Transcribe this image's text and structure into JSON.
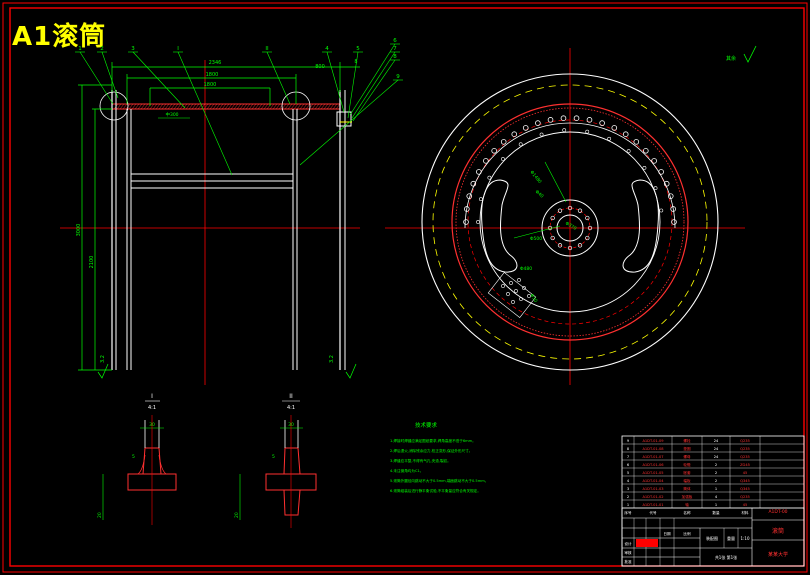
{
  "title": "A1滚筒",
  "colors": {
    "background": "#000000",
    "frame": "#ff0000",
    "outline": "#ffffff",
    "dim": "#00ff00",
    "center": "#ff0000",
    "hidden": "#ffff00",
    "title": "#ffff00",
    "table": "#ff0000"
  },
  "front_view": {
    "callouts": [
      "1",
      "2",
      "3",
      "I",
      "II",
      "4",
      "5",
      "6",
      "7",
      "8",
      "9"
    ],
    "dims": {
      "top1": "2346",
      "top2": "1800",
      "top3": "1800",
      "left_outer": "3000",
      "left_inner": "2100",
      "right_top": "800",
      "right_small": "8",
      "inner_small": "中300",
      "bottom_left": "3.2",
      "bottom_right": "3.2"
    }
  },
  "side_view": {
    "surface_note": "其余",
    "dims": {
      "d_bolt": "Φ1480",
      "d_hub": "Φ370",
      "d_pitch": "Φ1480",
      "d_hole": "Φ40",
      "d_inner": "Φ500",
      "d_small": "Φ30",
      "d_slot": "Φ480"
    }
  },
  "details": [
    {
      "label": "I",
      "scale": "4:1",
      "dim_top": "30",
      "dim_side": "5",
      "dim_height": "20"
    },
    {
      "label": "II",
      "scale": "4:1",
      "dim_top": "30",
      "dim_side": "5",
      "dim_height": "20"
    }
  ],
  "tech_notes": {
    "title": "技术要求",
    "lines": [
      "1.焊接时焊缝应满足图纸要求,焊角高度不低于6mm。",
      "2.焊后退火,消除残余应力,校正变形,保证外形尺寸。",
      "3.焊缝应平整,不得有气孔,夹渣,裂纹。",
      "4.未注倒角均为C1。",
      "5.滚筒外圆径向跳动不大于0.5mm,端面跳动不大于0.5mm。",
      "6.滚筒组装后进行静平衡试验,不平衡量应符合有关规定。"
    ]
  },
  "parts_list": {
    "rows": [
      {
        "no": "9",
        "code": "A1DT-01-09",
        "name": "螺栓",
        "qty": "24",
        "mat": "Q235"
      },
      {
        "no": "8",
        "code": "A1DT-01-08",
        "name": "垫圈",
        "qty": "24",
        "mat": "Q235"
      },
      {
        "no": "7",
        "code": "A1DT-01-07",
        "name": "螺母",
        "qty": "24",
        "mat": "Q235"
      },
      {
        "no": "6",
        "code": "A1DT-01-06",
        "name": "轮毂",
        "qty": "2",
        "mat": "ZG45"
      },
      {
        "no": "5",
        "code": "A1DT-01-05",
        "name": "胀套",
        "qty": "2",
        "mat": "45"
      },
      {
        "no": "4",
        "code": "A1DT-01-04",
        "name": "幅板",
        "qty": "2",
        "mat": "Q345"
      },
      {
        "no": "3",
        "code": "A1DT-01-03",
        "name": "筒体",
        "qty": "1",
        "mat": "Q345"
      },
      {
        "no": "2",
        "code": "A1DT-01-02",
        "name": "加强板",
        "qty": "4",
        "mat": "Q235"
      },
      {
        "no": "1",
        "code": "A1DT-01-01",
        "name": "轴",
        "qty": "1",
        "mat": "45"
      }
    ],
    "header": {
      "no": "序号",
      "code": "代号",
      "name": "名称",
      "qty": "数量",
      "mat": "材料"
    }
  },
  "title_block": {
    "drawing_no": "A1DT-00",
    "name": "滚筒",
    "scale": "1:10",
    "company": "某某大学",
    "material": "装配图",
    "sheet": "共1张 第1张",
    "designer": "设计",
    "checker": "审核",
    "approver": "批准",
    "date": "日期",
    "weight": "重量",
    "ratio": "比例"
  }
}
